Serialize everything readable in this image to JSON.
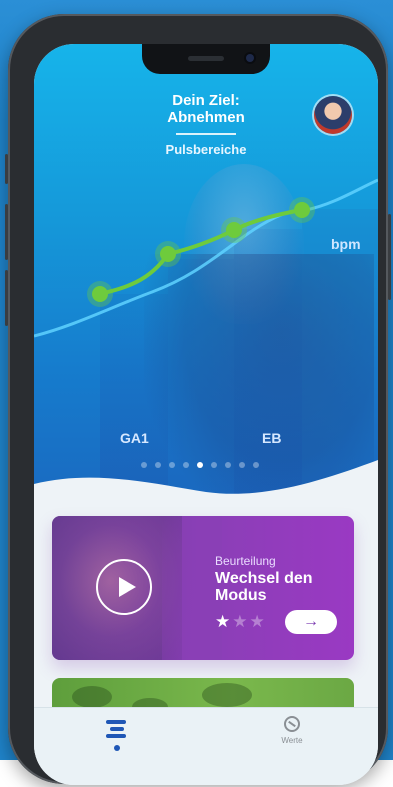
{
  "hero": {
    "goal_title": "Dein Ziel:",
    "goal_value": "Abnehmen",
    "section_title": "Pulsbereiche",
    "unit_label": "bpm",
    "zones": [
      "GA1",
      "EB"
    ],
    "carousel": {
      "count": 9,
      "active_index": 4
    }
  },
  "card": {
    "kicker": "Beurteilung",
    "title": "Wechsel den Modus",
    "rating": 1,
    "rating_max": 3,
    "arrow_label": "→"
  },
  "tabbar": {
    "werte_label": "Werte"
  },
  "colors": {
    "hero_top": "#16b4ea",
    "hero_bottom": "#1a69c0",
    "chart_line": "#6ecb3c",
    "card_purple": "#8a3fb6",
    "accent_blue": "#1f57b6"
  },
  "icons": {
    "play": "play-icon",
    "arrow": "arrow-right-icon",
    "home": "home-bars-icon",
    "werte": "ball-icon"
  }
}
